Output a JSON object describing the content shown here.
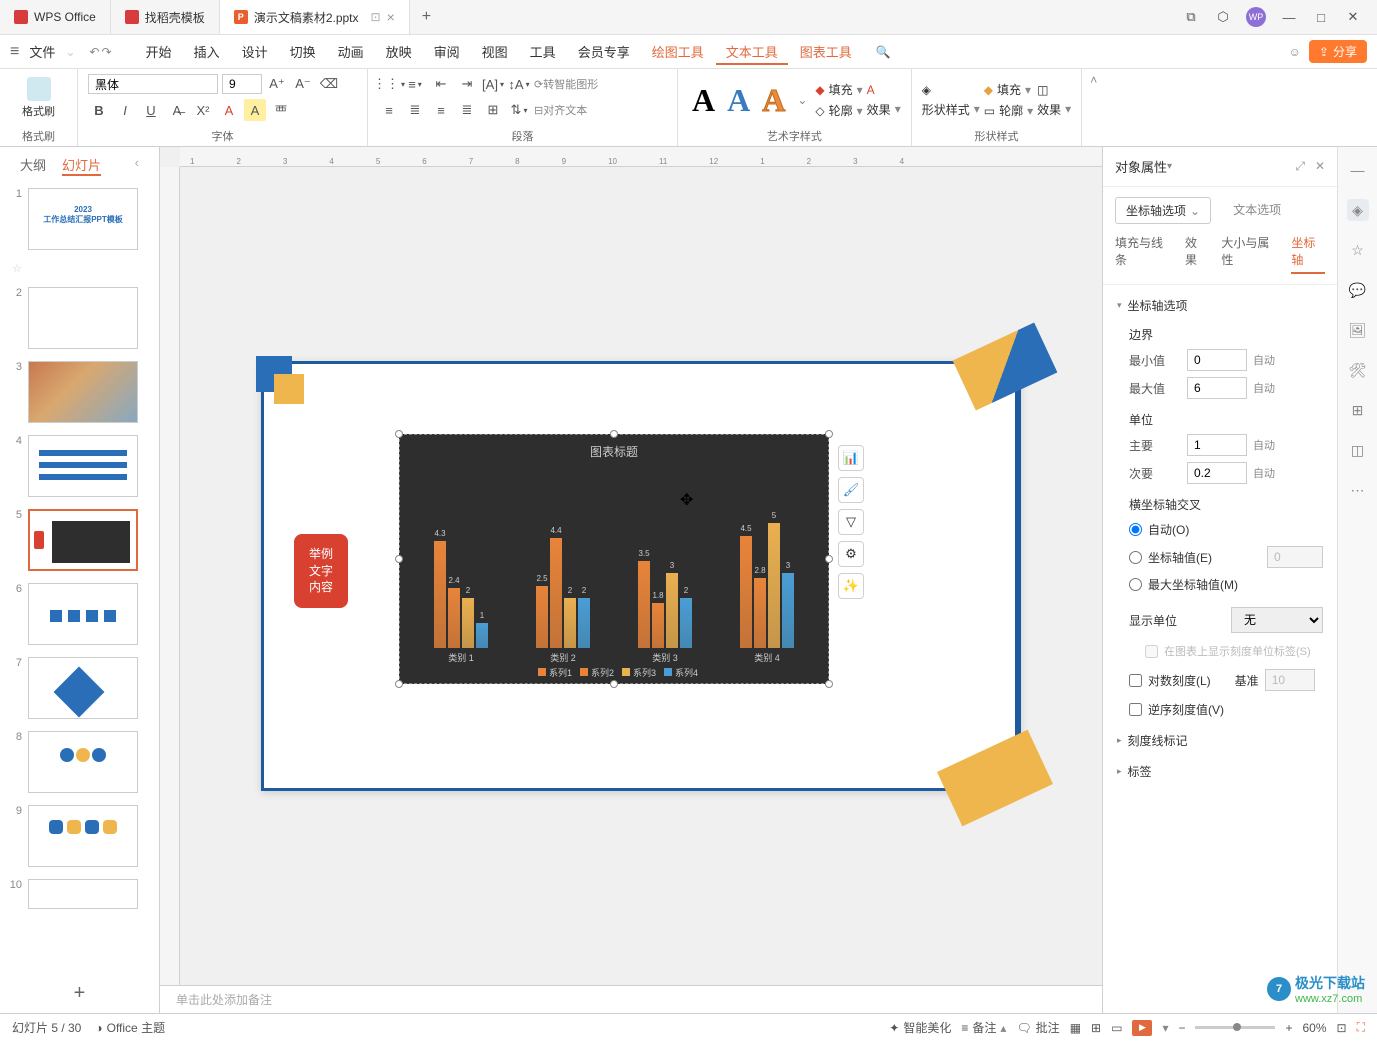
{
  "titlebar": {
    "tabs": [
      {
        "icon": "wps",
        "label": "WPS Office"
      },
      {
        "icon": "d",
        "label": "找稻壳模板"
      },
      {
        "icon": "p",
        "label": "演示文稿素材2.pptx",
        "active": true
      }
    ],
    "add": "+"
  },
  "menubar": {
    "file": "文件",
    "items": [
      "开始",
      "插入",
      "设计",
      "切换",
      "动画",
      "放映",
      "审阅",
      "视图",
      "工具",
      "会员专享"
    ],
    "accent": [
      "绘图工具",
      "文本工具",
      "图表工具"
    ],
    "active_accent": "文本工具",
    "share": "分享"
  },
  "ribbon": {
    "format_brush": "格式刷",
    "font_name": "黑体",
    "font_size": "9",
    "font_group": "字体",
    "paragraph_group": "段落",
    "smart_shape": "转智能图形",
    "align_text": "对齐文本",
    "wordart_group": "艺术字样式",
    "fill": "填充",
    "outline": "轮廓",
    "effects": "效果",
    "shape_style": "形状样式",
    "shape_fill": "填充",
    "shape_outline": "轮廓",
    "shape_effects": "效果",
    "shape_style_label": "形状样式"
  },
  "thumbs": {
    "tabs": {
      "outline": "大纲",
      "slides": "幻灯片"
    },
    "count": 10,
    "selected": 5
  },
  "slide": {
    "red_badge": "举例\n文字\n内容",
    "notes_placeholder": "单击此处添加备注"
  },
  "chart_data": {
    "type": "bar",
    "title": "图表标题",
    "categories": [
      "类别 1",
      "类别 2",
      "类别 3",
      "类别 4"
    ],
    "series": [
      {
        "name": "系列1",
        "values": [
          4.3,
          2.5,
          3.5,
          4.5
        ],
        "color": "#e8843a"
      },
      {
        "name": "系列2",
        "values": [
          2.4,
          4.4,
          1.8,
          2.8
        ],
        "color": "#e8843a"
      },
      {
        "name": "系列3",
        "values": [
          2.0,
          2.0,
          3.0,
          5.0
        ],
        "color": "#eab050"
      },
      {
        "name": "系列4",
        "values": [
          1.0,
          2.0,
          2.0,
          3.0
        ],
        "color": "#4a9ed4"
      }
    ],
    "ylim": [
      0,
      6
    ]
  },
  "props": {
    "title": "对象属性",
    "type_dropdown": "坐标轴选项",
    "text_options": "文本选项",
    "subtabs": [
      "填充与线条",
      "效果",
      "大小与属性",
      "坐标轴"
    ],
    "active_subtab": "坐标轴",
    "section_axis_options": "坐标轴选项",
    "bounds": "边界",
    "min_label": "最小值",
    "min_value": "0",
    "max_label": "最大值",
    "max_value": "6",
    "auto": "自动",
    "units": "单位",
    "major_label": "主要",
    "major_value": "1",
    "minor_label": "次要",
    "minor_value": "0.2",
    "h_axis_cross": "横坐标轴交叉",
    "radio_auto": "自动(O)",
    "radio_axis_value": "坐标轴值(E)",
    "radio_axis_value_v": "0",
    "radio_max_axis": "最大坐标轴值(M)",
    "display_unit": "显示单位",
    "display_unit_value": "无",
    "show_unit_label": "在图表上显示刻度单位标签(S)",
    "log_scale": "对数刻度(L)",
    "log_base": "基准",
    "log_base_value": "10",
    "reverse_order": "逆序刻度值(V)",
    "section_tick_marks": "刻度线标记",
    "section_labels": "标签"
  },
  "statusbar": {
    "slide_info": "幻灯片 5 / 30",
    "theme": "Office 主题",
    "smart_beautify": "智能美化",
    "notes": "备注",
    "comments": "批注",
    "zoom": "60%"
  },
  "watermark": {
    "name": "极光下载站",
    "url": "www.xz7.com"
  }
}
